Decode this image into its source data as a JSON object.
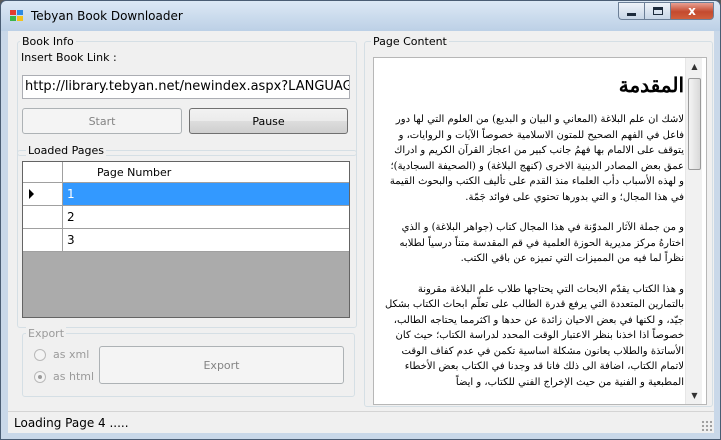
{
  "window": {
    "title": "Tebyan Book Downloader",
    "close_label": "x"
  },
  "book_info": {
    "group_label": "Book Info",
    "link_label": "Insert Book Link :",
    "link_value": "http://library.tebyan.net/newindex.aspx?LANGUAG",
    "start_label": "Start",
    "pause_label": "Pause"
  },
  "loaded_pages": {
    "group_label": "Loaded Pages",
    "column_header": "Page Number",
    "rows": [
      "1",
      "2",
      "3"
    ],
    "selected_row": 0
  },
  "export": {
    "group_label": "Export",
    "option_xml": "as xml",
    "option_html": "as html",
    "selected_option": "as html",
    "export_label": "Export"
  },
  "page_content": {
    "group_label": "Page Content",
    "heading": "المقدمة",
    "paragraphs": [
      "لاشك ان علم البلاغة (المعاني و البيان و البديع) من العلوم التي لها دور فاعل في الفهم الصحيح للمتون الاسلامية خصوصاً الآيات و الروايات، و يتوقف على الالمام بها فهمُ جانب كبير من اعجاز القرآن الكريم و ادراك عمق بعض المصادر الدينية الاخرى (كنهج البلاغة) و (الصحيفة السجادية)؛ و لهذه الأسباب دأب العلماء منذ القدم على تأليف الكتب والبحوث القيمة في هذا المجال؛ و التي بدورها تحتوي على فوائد جَمّة.",
      "و من جملة الآثار المدوّنة في هذا المجال كتاب (جواهر البلاغة) و الذي اختارهُ مركز مديرية الحوزة العلمية في قم المقدسة متناً درسياً لطلابه نظراً لما فيه من المميزات التي تميزه عن باقي الكتب.",
      "و هذا الكتاب يقدّم الابحاث التي يحتاجها طلاب علم البلاغة مقرونة بالتمارين المتعددة التي يرفع قدرة الطالب على تعلّم ابحاث الكتاب بشكل جيّد، و لكنها في بعض الاحيان زائدة عن حدها و اكثرمما يحتاجه الطالب، خصوصاً اذا اخذنا بنظر الاعتبار الوقت المحدد لدراسة الكتاب؛ حيث كان الأساتذة والطلاب يعانون مشكلة اساسية تكمن في عدم كفاف الوقت لاتمام الكتاب، اضافة الى ذلك فانا قد وجدنا في الكتاب بعض الأخطاء المطبعية و الفنية من حيث الإخراج الفني للكتاب، و ايضاً"
    ]
  },
  "status": {
    "text": "Loading Page 4   ....."
  },
  "colors": {
    "selection": "#3399ff",
    "grid_background": "#ababab",
    "window_frame": "#c9d8e9"
  },
  "icons": {
    "app": "app-icon",
    "minimize": "minimize-icon",
    "maximize": "maximize-icon",
    "close": "close-icon",
    "row_pointer": "row-pointer-icon",
    "scroll_up": "scroll-up-arrow-icon",
    "scroll_down": "scroll-down-arrow-icon",
    "size_grip": "size-grip-icon"
  }
}
